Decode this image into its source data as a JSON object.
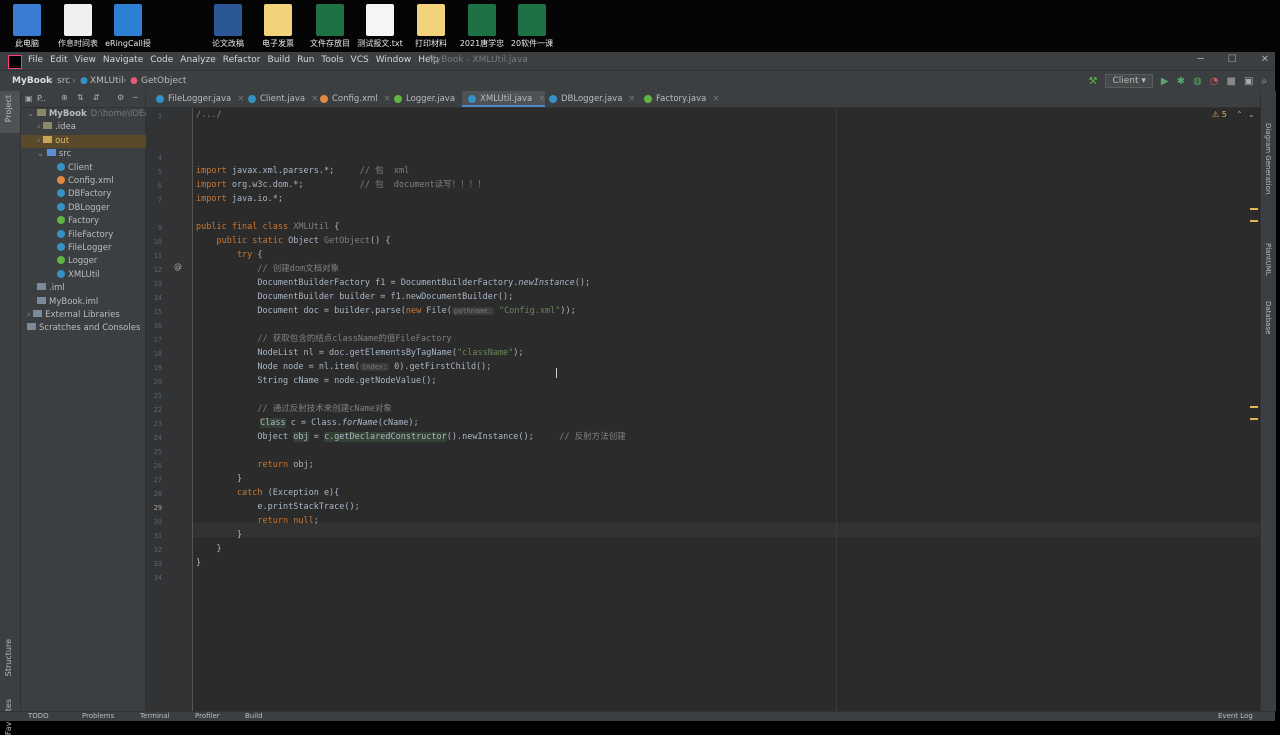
{
  "desktop": {
    "icons": [
      {
        "label": "此电脑",
        "color": "#3a7bd5",
        "name": "this-pc-icon"
      },
      {
        "label": "作息时间表",
        "color": "#f0f0f0",
        "name": "schedule-doc-icon"
      },
      {
        "label": "eRingCall授",
        "color": "#2d7fd3",
        "name": "eringcall-icon"
      },
      {
        "label": "论文改稿",
        "color": "#2b5797",
        "name": "word-doc-icon"
      },
      {
        "label": "电子发票",
        "color": "#f2d27a",
        "name": "invoice-folder-icon"
      },
      {
        "label": "文件存放目",
        "color": "#1e7145",
        "name": "excel-file-icon"
      },
      {
        "label": "测试报文.txt",
        "color": "#f5f5f5",
        "name": "text-file-icon"
      },
      {
        "label": "打印材料",
        "color": "#f2d27a",
        "name": "print-folder-icon"
      },
      {
        "label": "2021唐学忠",
        "color": "#1e7145",
        "name": "excel-file-icon"
      },
      {
        "label": "20软件一课",
        "color": "#1e7145",
        "name": "excel-file-icon"
      }
    ]
  },
  "titlebar": {
    "menus": [
      "File",
      "Edit",
      "View",
      "Navigate",
      "Code",
      "Analyze",
      "Refactor",
      "Build",
      "Run",
      "Tools",
      "VCS",
      "Window",
      "Help"
    ],
    "title": "MyBook - XMLUtil.java"
  },
  "navbar": {
    "project": "MyBook",
    "folder": "src",
    "class": "XMLUtil",
    "method": "GetObject",
    "run_config": "Client"
  },
  "project_panel": {
    "header": "P..",
    "tree": [
      {
        "label": "MyBook",
        "suffix": "D:\\home\\IDEA\\",
        "indent": 0,
        "kind": "project"
      },
      {
        "label": ".idea",
        "indent": 1,
        "kind": "folder"
      },
      {
        "label": "out",
        "indent": 1,
        "kind": "folder-out"
      },
      {
        "label": "src",
        "indent": 1,
        "kind": "folder"
      },
      {
        "label": "Client",
        "indent": 2,
        "kind": "class"
      },
      {
        "label": "Config.xml",
        "indent": 2,
        "kind": "xml"
      },
      {
        "label": "DBFactory",
        "indent": 2,
        "kind": "class"
      },
      {
        "label": "DBLogger",
        "indent": 2,
        "kind": "class"
      },
      {
        "label": "Factory",
        "indent": 2,
        "kind": "interface"
      },
      {
        "label": "FileFactory",
        "indent": 2,
        "kind": "class"
      },
      {
        "label": "FileLogger",
        "indent": 2,
        "kind": "class"
      },
      {
        "label": "Logger",
        "indent": 2,
        "kind": "interface"
      },
      {
        "label": "XMLUtil",
        "indent": 2,
        "kind": "class"
      },
      {
        "label": ".iml",
        "indent": 1,
        "kind": "file"
      },
      {
        "label": "MyBook.iml",
        "indent": 1,
        "kind": "file"
      },
      {
        "label": "External Libraries",
        "indent": 0,
        "kind": "lib"
      },
      {
        "label": "Scratches and Consoles",
        "indent": 0,
        "kind": "scratch"
      }
    ]
  },
  "tabs": [
    {
      "label": "FileLogger.java",
      "color": "#3592c4"
    },
    {
      "label": "Client.java",
      "color": "#3592c4"
    },
    {
      "label": "Config.xml",
      "color": "#e08944"
    },
    {
      "label": "Logger.java",
      "color": "#62b543"
    },
    {
      "label": "XMLUtil.java",
      "color": "#3592c4",
      "active": true
    },
    {
      "label": "DBLogger.java",
      "color": "#3592c4"
    },
    {
      "label": "Factory.java",
      "color": "#62b543"
    }
  ],
  "editor": {
    "warnings": "5",
    "line_numbers": [
      "1",
      "",
      "",
      "4",
      "5",
      "6",
      "7",
      "",
      "9",
      "10",
      "11",
      "12",
      "13",
      "14",
      "15",
      "16",
      "17",
      "18",
      "19",
      "20",
      "21",
      "22",
      "23",
      "24",
      "25",
      "26",
      "27",
      "28",
      "29",
      "30",
      "31",
      "32",
      "33",
      "34"
    ],
    "code": {
      "l1": "/.../",
      "l4a": "import",
      "l4b": " javax.xml.parsers.*;",
      "l4c": "     // 包  xml",
      "l5a": "import",
      "l5b": " org.w3c.dom.*;",
      "l5c": "           // 包  document读写！！！！",
      "l6a": "import",
      "l6b": " java.io.*;",
      "l8a": "public final class",
      "l8b": " XMLUtil",
      "l8c": " {",
      "l9a": "    public static",
      "l9b": " Object ",
      "l9c": "GetObject",
      "l9d": "() {",
      "l10a": "        try",
      "l10b": " {",
      "l11": "            // 创建dom文档对象",
      "l12a": "            DocumentBuilderFactory f1 = DocumentBuilderFactory.",
      "l12b": "newInstance",
      "l12c": "();",
      "l13": "            DocumentBuilder builder = f1.newDocumentBuilder();",
      "l14a": "            Document doc = builder.parse(",
      "l14b": "new",
      "l14c": " File(",
      "l14d": "pathname:",
      "l14e": " \"Config.xml\"",
      "l14f": "));",
      "l16": "            // 获取包含的结点className的值FileFactory",
      "l17a": "            NodeList nl = doc.getElementsByTagName(",
      "l17b": "\"className\"",
      "l17c": ");",
      "l18a": "            Node node = nl.item(",
      "l18b": "index:",
      "l18c": " 0).getFirstChild();",
      "l19": "            String cName = node.getNodeValue();",
      "l21": "            // 通过反射技术来创建cName对象",
      "l22a": "Class",
      "l22b": " c = Class.",
      "l22c": "forName",
      "l22d": "(cName);",
      "l23a": "            Object ",
      "l23b": "obj",
      "l23c": " = ",
      "l23d": "c.getDeclaredConstructor",
      "l23e": "().newInstance();",
      "l23f": "     // 反射方法创建",
      "l25a": "            return",
      "l25b": " obj;",
      "l26": "        }",
      "l27a": "        catch",
      "l27b": " (Exception e){",
      "l28": "            e.printStackTrace();",
      "l29a": "            return null",
      "l29b": ";",
      "l30": "        }",
      "l31": "    }",
      "l32": "}"
    }
  },
  "right_strip": [
    "Diagram Generation",
    "PlantUML",
    "Database"
  ],
  "left_strip": [
    "Project",
    "Structure",
    "Favorites"
  ],
  "bottom_tabs": [
    "TODO",
    "Problems",
    "Terminal",
    "Profiler",
    "Build",
    "Event Log"
  ]
}
